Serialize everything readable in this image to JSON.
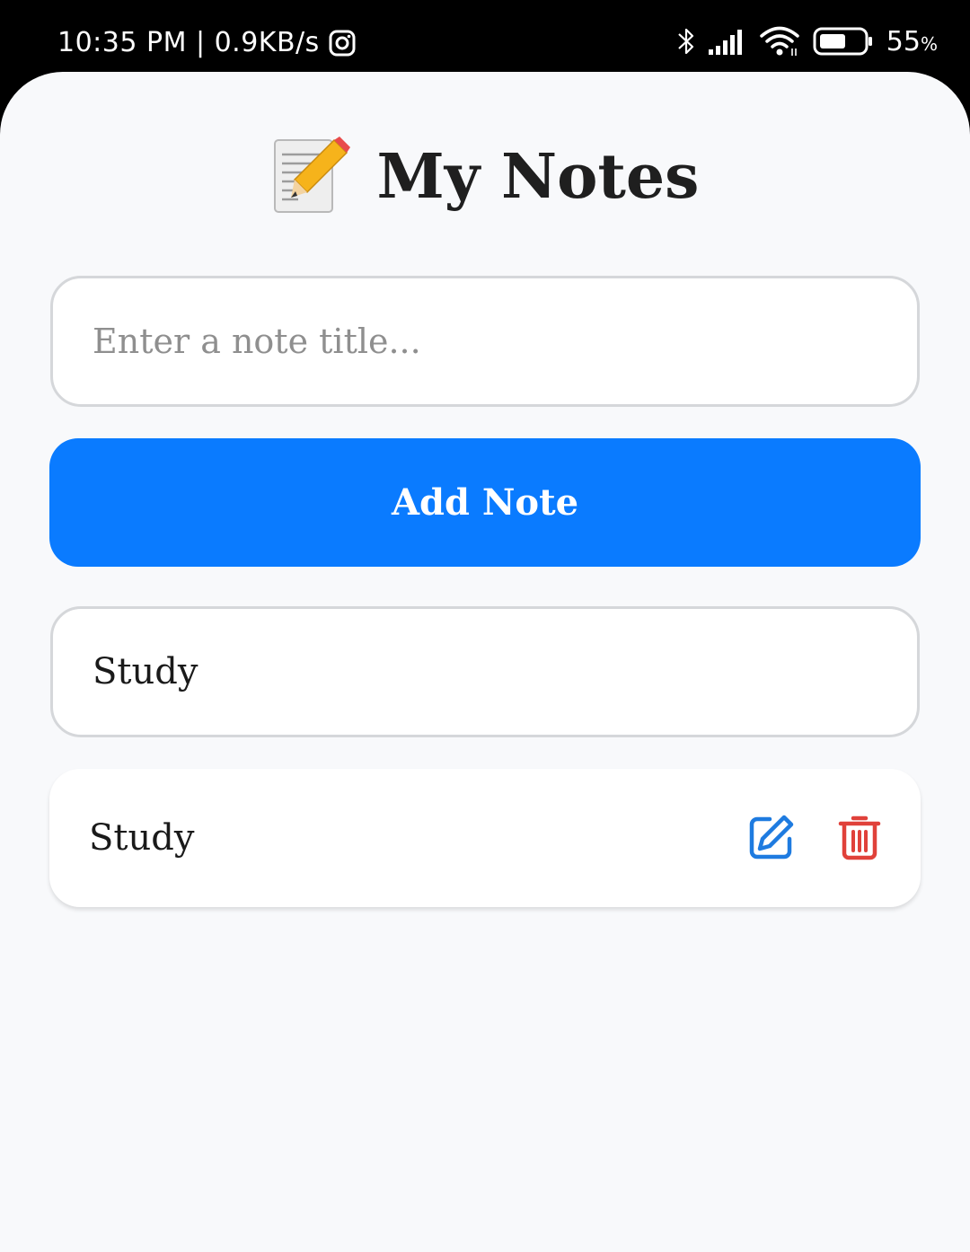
{
  "status_bar": {
    "time": "10:35 PM",
    "separator": "|",
    "network_speed": "0.9KB/s",
    "battery_value": "55",
    "battery_unit": "%",
    "icons": [
      "instagram-icon",
      "bluetooth-icon",
      "signal-icon",
      "wifi-icon",
      "battery-icon"
    ]
  },
  "header": {
    "emoji": "📝",
    "title": "My Notes"
  },
  "input": {
    "placeholder": "Enter a note title...",
    "value": ""
  },
  "add_button": {
    "label": "Add Note"
  },
  "editing": {
    "value": "Study"
  },
  "notes": [
    {
      "title": "Study",
      "actions": [
        "edit-icon",
        "delete-icon"
      ]
    }
  ],
  "colors": {
    "accent": "#0a7bff",
    "edit": "#1e7be0",
    "delete": "#e0413a",
    "background": "#f8f9fb"
  }
}
